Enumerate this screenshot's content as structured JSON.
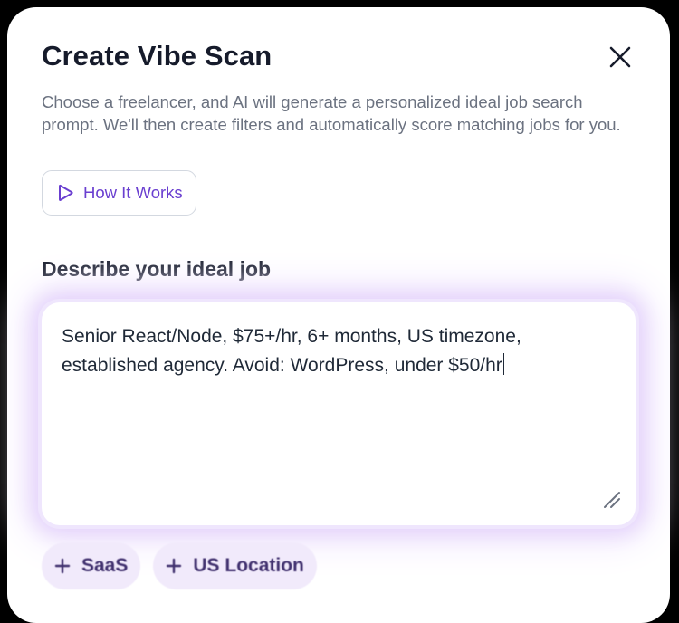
{
  "modal": {
    "title": "Create Vibe Scan",
    "description": "Choose a freelancer, and AI will generate a personalized ideal job search prompt. We'll then create filters and automatically score matching jobs for you.",
    "how_it_works_label": "How It Works",
    "close_icon": "close-icon",
    "play_icon": "play-icon"
  },
  "ideal_job": {
    "label": "Describe your ideal job",
    "value": "Senior React/Node, $75+/hr, 6+ months, US timezone, established agency. Avoid: WordPress, under $50/hr",
    "resize_icon": "resize-handle-icon"
  },
  "suggestions": [
    {
      "label": "SaaS",
      "icon": "plus-icon"
    },
    {
      "label": "US Location",
      "icon": "plus-icon"
    }
  ],
  "colors": {
    "accent": "#6a3fd0",
    "chip_bg": "#f1eafb",
    "glow": "#e4d2fb",
    "title": "#161b2b",
    "muted": "#6b7280"
  }
}
